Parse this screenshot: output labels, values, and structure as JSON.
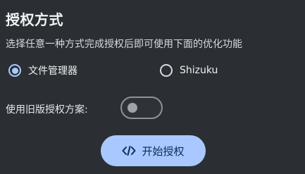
{
  "section": {
    "title": "授权方式",
    "description": "选择任意一种方式完成授权后即可使用下面的优化功能"
  },
  "options": [
    {
      "label": "文件管理器",
      "selected": true
    },
    {
      "label": "Shizuku",
      "selected": false
    }
  ],
  "legacy": {
    "label": "使用旧版授权方案:",
    "enabled": false
  },
  "action": {
    "label": "开始授权",
    "icon": "code-icon"
  },
  "colors": {
    "background": "#2b2f33",
    "accent": "#a9c8ff",
    "button_text": "#0d2b57"
  }
}
